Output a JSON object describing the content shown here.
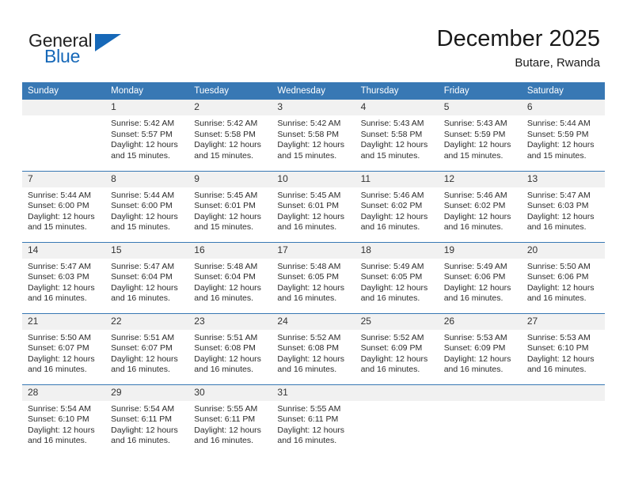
{
  "brand": {
    "name_part1": "General",
    "name_part2": "Blue",
    "logo_icon": "triangle-logo-icon"
  },
  "header": {
    "month_title": "December 2025",
    "location": "Butare, Rwanda"
  },
  "colors": {
    "header_blue": "#3878b4",
    "brand_blue": "#1668b8",
    "daynum_bg": "#f1f1f1",
    "text": "#2b2b2b"
  },
  "calendar": {
    "weekday_headers": [
      "Sunday",
      "Monday",
      "Tuesday",
      "Wednesday",
      "Thursday",
      "Friday",
      "Saturday"
    ],
    "weeks": [
      [
        {
          "day": "",
          "sunrise": "",
          "sunset": "",
          "daylight": "",
          "empty": true
        },
        {
          "day": "1",
          "sunrise": "Sunrise: 5:42 AM",
          "sunset": "Sunset: 5:57 PM",
          "daylight": "Daylight: 12 hours and 15 minutes.",
          "empty": false
        },
        {
          "day": "2",
          "sunrise": "Sunrise: 5:42 AM",
          "sunset": "Sunset: 5:58 PM",
          "daylight": "Daylight: 12 hours and 15 minutes.",
          "empty": false
        },
        {
          "day": "3",
          "sunrise": "Sunrise: 5:42 AM",
          "sunset": "Sunset: 5:58 PM",
          "daylight": "Daylight: 12 hours and 15 minutes.",
          "empty": false
        },
        {
          "day": "4",
          "sunrise": "Sunrise: 5:43 AM",
          "sunset": "Sunset: 5:58 PM",
          "daylight": "Daylight: 12 hours and 15 minutes.",
          "empty": false
        },
        {
          "day": "5",
          "sunrise": "Sunrise: 5:43 AM",
          "sunset": "Sunset: 5:59 PM",
          "daylight": "Daylight: 12 hours and 15 minutes.",
          "empty": false
        },
        {
          "day": "6",
          "sunrise": "Sunrise: 5:44 AM",
          "sunset": "Sunset: 5:59 PM",
          "daylight": "Daylight: 12 hours and 15 minutes.",
          "empty": false
        }
      ],
      [
        {
          "day": "7",
          "sunrise": "Sunrise: 5:44 AM",
          "sunset": "Sunset: 6:00 PM",
          "daylight": "Daylight: 12 hours and 15 minutes.",
          "empty": false
        },
        {
          "day": "8",
          "sunrise": "Sunrise: 5:44 AM",
          "sunset": "Sunset: 6:00 PM",
          "daylight": "Daylight: 12 hours and 15 minutes.",
          "empty": false
        },
        {
          "day": "9",
          "sunrise": "Sunrise: 5:45 AM",
          "sunset": "Sunset: 6:01 PM",
          "daylight": "Daylight: 12 hours and 15 minutes.",
          "empty": false
        },
        {
          "day": "10",
          "sunrise": "Sunrise: 5:45 AM",
          "sunset": "Sunset: 6:01 PM",
          "daylight": "Daylight: 12 hours and 16 minutes.",
          "empty": false
        },
        {
          "day": "11",
          "sunrise": "Sunrise: 5:46 AM",
          "sunset": "Sunset: 6:02 PM",
          "daylight": "Daylight: 12 hours and 16 minutes.",
          "empty": false
        },
        {
          "day": "12",
          "sunrise": "Sunrise: 5:46 AM",
          "sunset": "Sunset: 6:02 PM",
          "daylight": "Daylight: 12 hours and 16 minutes.",
          "empty": false
        },
        {
          "day": "13",
          "sunrise": "Sunrise: 5:47 AM",
          "sunset": "Sunset: 6:03 PM",
          "daylight": "Daylight: 12 hours and 16 minutes.",
          "empty": false
        }
      ],
      [
        {
          "day": "14",
          "sunrise": "Sunrise: 5:47 AM",
          "sunset": "Sunset: 6:03 PM",
          "daylight": "Daylight: 12 hours and 16 minutes.",
          "empty": false
        },
        {
          "day": "15",
          "sunrise": "Sunrise: 5:47 AM",
          "sunset": "Sunset: 6:04 PM",
          "daylight": "Daylight: 12 hours and 16 minutes.",
          "empty": false
        },
        {
          "day": "16",
          "sunrise": "Sunrise: 5:48 AM",
          "sunset": "Sunset: 6:04 PM",
          "daylight": "Daylight: 12 hours and 16 minutes.",
          "empty": false
        },
        {
          "day": "17",
          "sunrise": "Sunrise: 5:48 AM",
          "sunset": "Sunset: 6:05 PM",
          "daylight": "Daylight: 12 hours and 16 minutes.",
          "empty": false
        },
        {
          "day": "18",
          "sunrise": "Sunrise: 5:49 AM",
          "sunset": "Sunset: 6:05 PM",
          "daylight": "Daylight: 12 hours and 16 minutes.",
          "empty": false
        },
        {
          "day": "19",
          "sunrise": "Sunrise: 5:49 AM",
          "sunset": "Sunset: 6:06 PM",
          "daylight": "Daylight: 12 hours and 16 minutes.",
          "empty": false
        },
        {
          "day": "20",
          "sunrise": "Sunrise: 5:50 AM",
          "sunset": "Sunset: 6:06 PM",
          "daylight": "Daylight: 12 hours and 16 minutes.",
          "empty": false
        }
      ],
      [
        {
          "day": "21",
          "sunrise": "Sunrise: 5:50 AM",
          "sunset": "Sunset: 6:07 PM",
          "daylight": "Daylight: 12 hours and 16 minutes.",
          "empty": false
        },
        {
          "day": "22",
          "sunrise": "Sunrise: 5:51 AM",
          "sunset": "Sunset: 6:07 PM",
          "daylight": "Daylight: 12 hours and 16 minutes.",
          "empty": false
        },
        {
          "day": "23",
          "sunrise": "Sunrise: 5:51 AM",
          "sunset": "Sunset: 6:08 PM",
          "daylight": "Daylight: 12 hours and 16 minutes.",
          "empty": false
        },
        {
          "day": "24",
          "sunrise": "Sunrise: 5:52 AM",
          "sunset": "Sunset: 6:08 PM",
          "daylight": "Daylight: 12 hours and 16 minutes.",
          "empty": false
        },
        {
          "day": "25",
          "sunrise": "Sunrise: 5:52 AM",
          "sunset": "Sunset: 6:09 PM",
          "daylight": "Daylight: 12 hours and 16 minutes.",
          "empty": false
        },
        {
          "day": "26",
          "sunrise": "Sunrise: 5:53 AM",
          "sunset": "Sunset: 6:09 PM",
          "daylight": "Daylight: 12 hours and 16 minutes.",
          "empty": false
        },
        {
          "day": "27",
          "sunrise": "Sunrise: 5:53 AM",
          "sunset": "Sunset: 6:10 PM",
          "daylight": "Daylight: 12 hours and 16 minutes.",
          "empty": false
        }
      ],
      [
        {
          "day": "28",
          "sunrise": "Sunrise: 5:54 AM",
          "sunset": "Sunset: 6:10 PM",
          "daylight": "Daylight: 12 hours and 16 minutes.",
          "empty": false
        },
        {
          "day": "29",
          "sunrise": "Sunrise: 5:54 AM",
          "sunset": "Sunset: 6:11 PM",
          "daylight": "Daylight: 12 hours and 16 minutes.",
          "empty": false
        },
        {
          "day": "30",
          "sunrise": "Sunrise: 5:55 AM",
          "sunset": "Sunset: 6:11 PM",
          "daylight": "Daylight: 12 hours and 16 minutes.",
          "empty": false
        },
        {
          "day": "31",
          "sunrise": "Sunrise: 5:55 AM",
          "sunset": "Sunset: 6:11 PM",
          "daylight": "Daylight: 12 hours and 16 minutes.",
          "empty": false
        },
        {
          "day": "",
          "sunrise": "",
          "sunset": "",
          "daylight": "",
          "empty": true
        },
        {
          "day": "",
          "sunrise": "",
          "sunset": "",
          "daylight": "",
          "empty": true
        },
        {
          "day": "",
          "sunrise": "",
          "sunset": "",
          "daylight": "",
          "empty": true
        }
      ]
    ]
  }
}
